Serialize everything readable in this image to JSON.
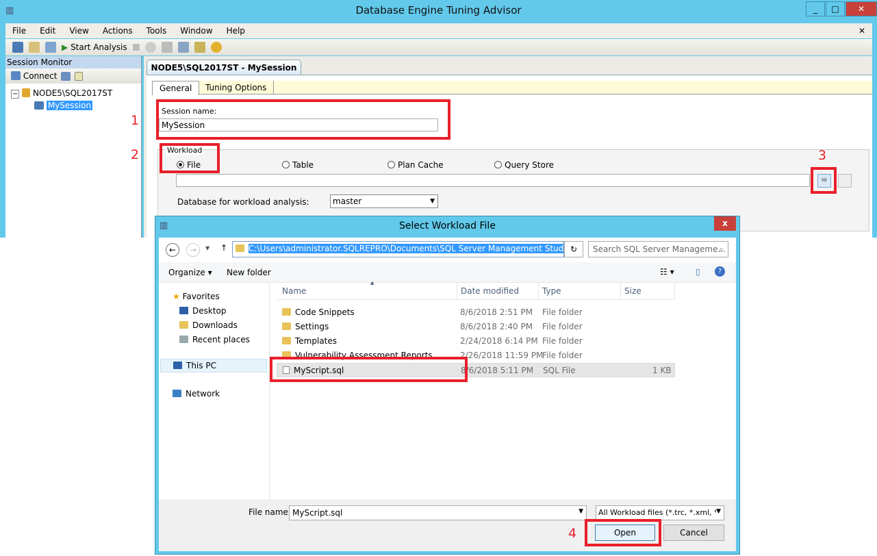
{
  "window": {
    "title": "Database Engine Tuning Advisor",
    "controls": [
      "_",
      "□",
      "✕"
    ]
  },
  "menu": [
    "File",
    "Edit",
    "View",
    "Actions",
    "Tools",
    "Window",
    "Help"
  ],
  "toolbar": {
    "start_analysis": "Start Analysis"
  },
  "session_monitor": {
    "title": "Session Monitor",
    "connect": "Connect",
    "server": "NODE5\\SQL2017ST",
    "session": "MySession"
  },
  "document": {
    "tab": "NODE5\\SQL2017ST - MySession",
    "tabs": [
      "General",
      "Tuning Options"
    ],
    "session_name_label": "Session name:",
    "session_name": "MySession",
    "workload_label": "Workload",
    "workload_options": [
      "File",
      "Table",
      "Plan Cache",
      "Query Store"
    ],
    "workload_selected": "File",
    "db_label": "Database for workload analysis:",
    "db_value": "master"
  },
  "annotations": [
    "1",
    "2",
    "3",
    "4"
  ],
  "dialog": {
    "title": "Select Workload File",
    "close": "x",
    "address": "C:\\Users\\administrator.SQLREPRO\\Documents\\SQL Server Management Studio",
    "search_placeholder": "Search SQL Server Manageme...",
    "organize": "Organize",
    "new_folder": "New folder",
    "nav": {
      "favorites": "Favorites",
      "items": [
        "Desktop",
        "Downloads",
        "Recent places"
      ],
      "this_pc": "This PC",
      "network": "Network"
    },
    "columns": [
      "Name",
      "Date modified",
      "Type",
      "Size"
    ],
    "files": [
      {
        "name": "Code Snippets",
        "date": "8/6/2018 2:51 PM",
        "type": "File folder",
        "size": ""
      },
      {
        "name": "Settings",
        "date": "8/6/2018 2:40 PM",
        "type": "File folder",
        "size": ""
      },
      {
        "name": "Templates",
        "date": "2/24/2018 6:14 PM",
        "type": "File folder",
        "size": ""
      },
      {
        "name": "Vulnerability Assessment Reports",
        "date": "2/26/2018 11:59 PM",
        "type": "File folder",
        "size": ""
      },
      {
        "name": "MyScript.sql",
        "date": "8/6/2018 5:11 PM",
        "type": "SQL File",
        "size": "1 KB"
      }
    ],
    "file_name_label": "File name:",
    "file_name": "MyScript.sql",
    "filter": "All Workload files (*.trc, *.xml, *",
    "open": "Open",
    "cancel": "Cancel"
  },
  "colors": {
    "titlebar": "#62c9ea",
    "annotation": "#e8202a",
    "selection": "#3399ff"
  }
}
